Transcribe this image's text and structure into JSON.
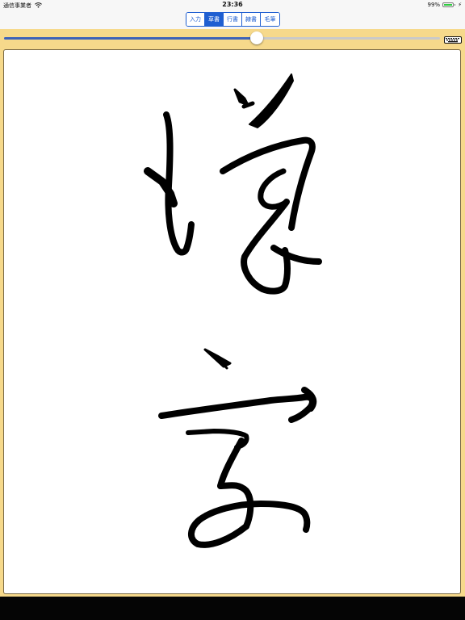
{
  "status_bar": {
    "carrier": "通信事業者",
    "time": "23:36",
    "battery_percent": "99%",
    "battery_level": 0.99
  },
  "segmented_control": {
    "items": [
      "入力",
      "草書",
      "行書",
      "隷書",
      "毛筆"
    ],
    "selected_index": 1
  },
  "slider": {
    "value": 0.58
  },
  "icons": {
    "keyboard": "keyboard-icon",
    "dismiss": "chevron-down-icon",
    "wifi": "wifi-icon",
    "charging": "charging-bolt-icon"
  },
  "colors": {
    "accent": "#1f5fd1",
    "panel": "#f6d98b",
    "ink": "#000000"
  }
}
